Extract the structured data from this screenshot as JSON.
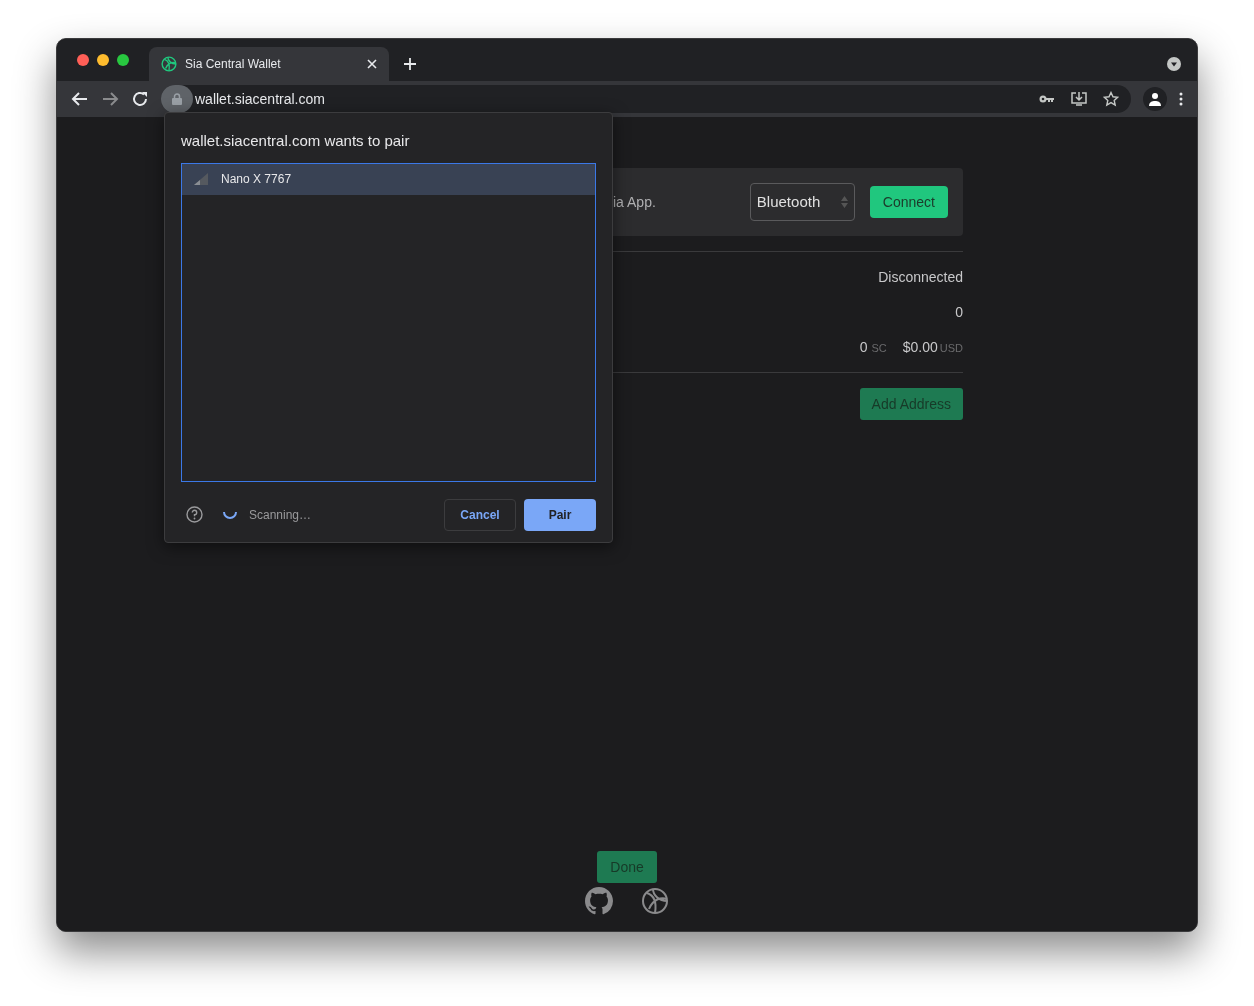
{
  "tabs": [
    {
      "title": "Sia Central Wallet",
      "selected": true
    }
  ],
  "address_bar": {
    "url": "wallet.siacentral.com"
  },
  "page": {
    "card": {
      "text": "ia App.",
      "transport_select": "Bluetooth",
      "connect_button": "Connect"
    },
    "status": "Disconnected",
    "count": "0",
    "balance": {
      "sc_amount": "0",
      "sc_unit": "SC",
      "usd_amount": "$0.00",
      "usd_unit": "USD"
    },
    "add_address_button": "Add Address",
    "done_button": "Done"
  },
  "dialog": {
    "title": "wallet.siacentral.com wants to pair",
    "devices": [
      {
        "name": "Nano X 7767",
        "selected": true
      }
    ],
    "status": "Scanning…",
    "cancel_button": "Cancel",
    "pair_button": "Pair"
  }
}
